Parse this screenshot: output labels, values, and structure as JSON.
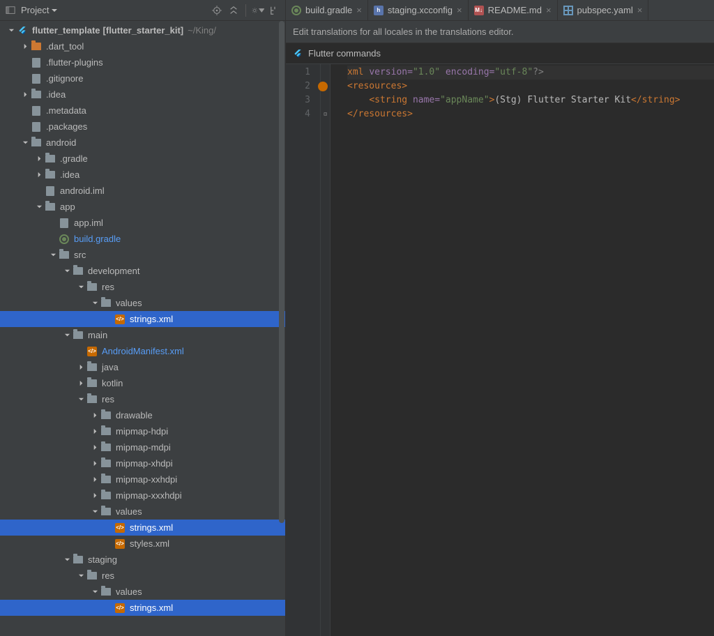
{
  "sidebar": {
    "title": "Project",
    "root": {
      "label": "flutter_template",
      "module": "[flutter_starter_kit]",
      "path": "~/King/"
    },
    "tree": [
      {
        "indent": 0,
        "arrow": "down",
        "icon": "flutter",
        "label": "flutter_template",
        "bold": true,
        "module": "[flutter_starter_kit]",
        "path": "~/King/"
      },
      {
        "indent": 1,
        "arrow": "right",
        "icon": "folder-orange",
        "label": ".dart_tool"
      },
      {
        "indent": 1,
        "arrow": "none",
        "icon": "file-grey",
        "label": ".flutter-plugins"
      },
      {
        "indent": 1,
        "arrow": "none",
        "icon": "file-grey",
        "label": ".gitignore"
      },
      {
        "indent": 1,
        "arrow": "right",
        "icon": "folder",
        "label": ".idea"
      },
      {
        "indent": 1,
        "arrow": "none",
        "icon": "file-grey",
        "label": ".metadata"
      },
      {
        "indent": 1,
        "arrow": "none",
        "icon": "file-grey",
        "label": ".packages"
      },
      {
        "indent": 1,
        "arrow": "down",
        "icon": "folder",
        "label": "android"
      },
      {
        "indent": 2,
        "arrow": "right",
        "icon": "folder",
        "label": ".gradle"
      },
      {
        "indent": 2,
        "arrow": "right",
        "icon": "folder",
        "label": ".idea"
      },
      {
        "indent": 2,
        "arrow": "none",
        "icon": "file-grey",
        "label": "android.iml"
      },
      {
        "indent": 2,
        "arrow": "down",
        "icon": "folder",
        "label": "app"
      },
      {
        "indent": 3,
        "arrow": "none",
        "icon": "file-grey",
        "label": "app.iml"
      },
      {
        "indent": 3,
        "arrow": "none",
        "icon": "gradle",
        "label": "build.gradle",
        "blue": true
      },
      {
        "indent": 3,
        "arrow": "down",
        "icon": "folder",
        "label": "src"
      },
      {
        "indent": 4,
        "arrow": "down",
        "icon": "folder",
        "label": "development"
      },
      {
        "indent": 5,
        "arrow": "down",
        "icon": "folder",
        "label": "res"
      },
      {
        "indent": 6,
        "arrow": "down",
        "icon": "folder",
        "label": "values"
      },
      {
        "indent": 7,
        "arrow": "none",
        "icon": "xml",
        "label": "strings.xml",
        "selected": true
      },
      {
        "indent": 4,
        "arrow": "down",
        "icon": "folder",
        "label": "main"
      },
      {
        "indent": 5,
        "arrow": "none",
        "icon": "xml",
        "label": "AndroidManifest.xml",
        "blue": true
      },
      {
        "indent": 5,
        "arrow": "right",
        "icon": "folder",
        "label": "java"
      },
      {
        "indent": 5,
        "arrow": "right",
        "icon": "folder",
        "label": "kotlin"
      },
      {
        "indent": 5,
        "arrow": "down",
        "icon": "folder",
        "label": "res"
      },
      {
        "indent": 6,
        "arrow": "right",
        "icon": "folder",
        "label": "drawable"
      },
      {
        "indent": 6,
        "arrow": "right",
        "icon": "folder",
        "label": "mipmap-hdpi"
      },
      {
        "indent": 6,
        "arrow": "right",
        "icon": "folder",
        "label": "mipmap-mdpi"
      },
      {
        "indent": 6,
        "arrow": "right",
        "icon": "folder",
        "label": "mipmap-xhdpi"
      },
      {
        "indent": 6,
        "arrow": "right",
        "icon": "folder",
        "label": "mipmap-xxhdpi"
      },
      {
        "indent": 6,
        "arrow": "right",
        "icon": "folder",
        "label": "mipmap-xxxhdpi"
      },
      {
        "indent": 6,
        "arrow": "down",
        "icon": "folder",
        "label": "values"
      },
      {
        "indent": 7,
        "arrow": "none",
        "icon": "xml",
        "label": "strings.xml",
        "selected": true
      },
      {
        "indent": 7,
        "arrow": "none",
        "icon": "xml",
        "label": "styles.xml"
      },
      {
        "indent": 4,
        "arrow": "down",
        "icon": "folder",
        "label": "staging"
      },
      {
        "indent": 5,
        "arrow": "down",
        "icon": "folder",
        "label": "res"
      },
      {
        "indent": 6,
        "arrow": "down",
        "icon": "folder",
        "label": "values"
      },
      {
        "indent": 7,
        "arrow": "none",
        "icon": "xml",
        "label": "strings.xml",
        "selected": true
      }
    ]
  },
  "tabs": [
    {
      "icon": "gradle",
      "label": "build.gradle"
    },
    {
      "icon": "cpp",
      "label": "staging.xcconfig"
    },
    {
      "icon": "md",
      "label": "README.md"
    },
    {
      "icon": "yaml",
      "label": "pubspec.yaml"
    }
  ],
  "banner": "Edit translations for all locales in the translations editor.",
  "flutterbar": "Flutter commands",
  "code": {
    "lines": [
      "1",
      "2",
      "3",
      "4"
    ],
    "xml": {
      "decl_open": "<?",
      "decl_name": "xml ",
      "decl_attr1": "version=",
      "decl_val1": "\"1.0\" ",
      "decl_attr2": "encoding=",
      "decl_val2": "\"utf-8\"",
      "decl_close": "?>",
      "res_open": "<resources>",
      "string_open": "<string ",
      "string_attr": "name=",
      "string_val": "\"appName\"",
      "string_close": ">",
      "string_text": "(Stg) Flutter Starter Kit",
      "string_end": "</string>",
      "res_close": "</resources>"
    }
  }
}
